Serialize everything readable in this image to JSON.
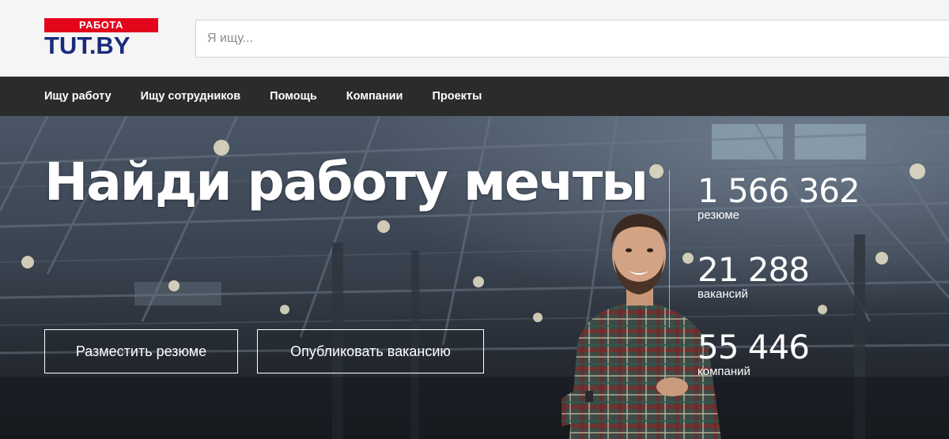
{
  "header": {
    "logo_top": "РАБОТА",
    "logo_bottom": "TUT.BY",
    "search_placeholder": "Я ищу..."
  },
  "nav": {
    "items": [
      "Ищу работу",
      "Ищу сотрудников",
      "Помощь",
      "Компании",
      "Проекты"
    ]
  },
  "hero": {
    "title": "Найди работу мечты",
    "buttons": {
      "resume": "Разместить резюме",
      "vacancy": "Опубликовать вакансию"
    },
    "stats": [
      {
        "value": "1 566 362",
        "label": "резюме"
      },
      {
        "value": "21 288",
        "label": "вакансий"
      },
      {
        "value": "55 446",
        "label": "компаний"
      }
    ]
  },
  "colors": {
    "logo_red": "#e3051b",
    "logo_blue": "#1b2a7a",
    "nav_bg": "#2b2b2b",
    "header_bg": "#f5f5f5"
  }
}
